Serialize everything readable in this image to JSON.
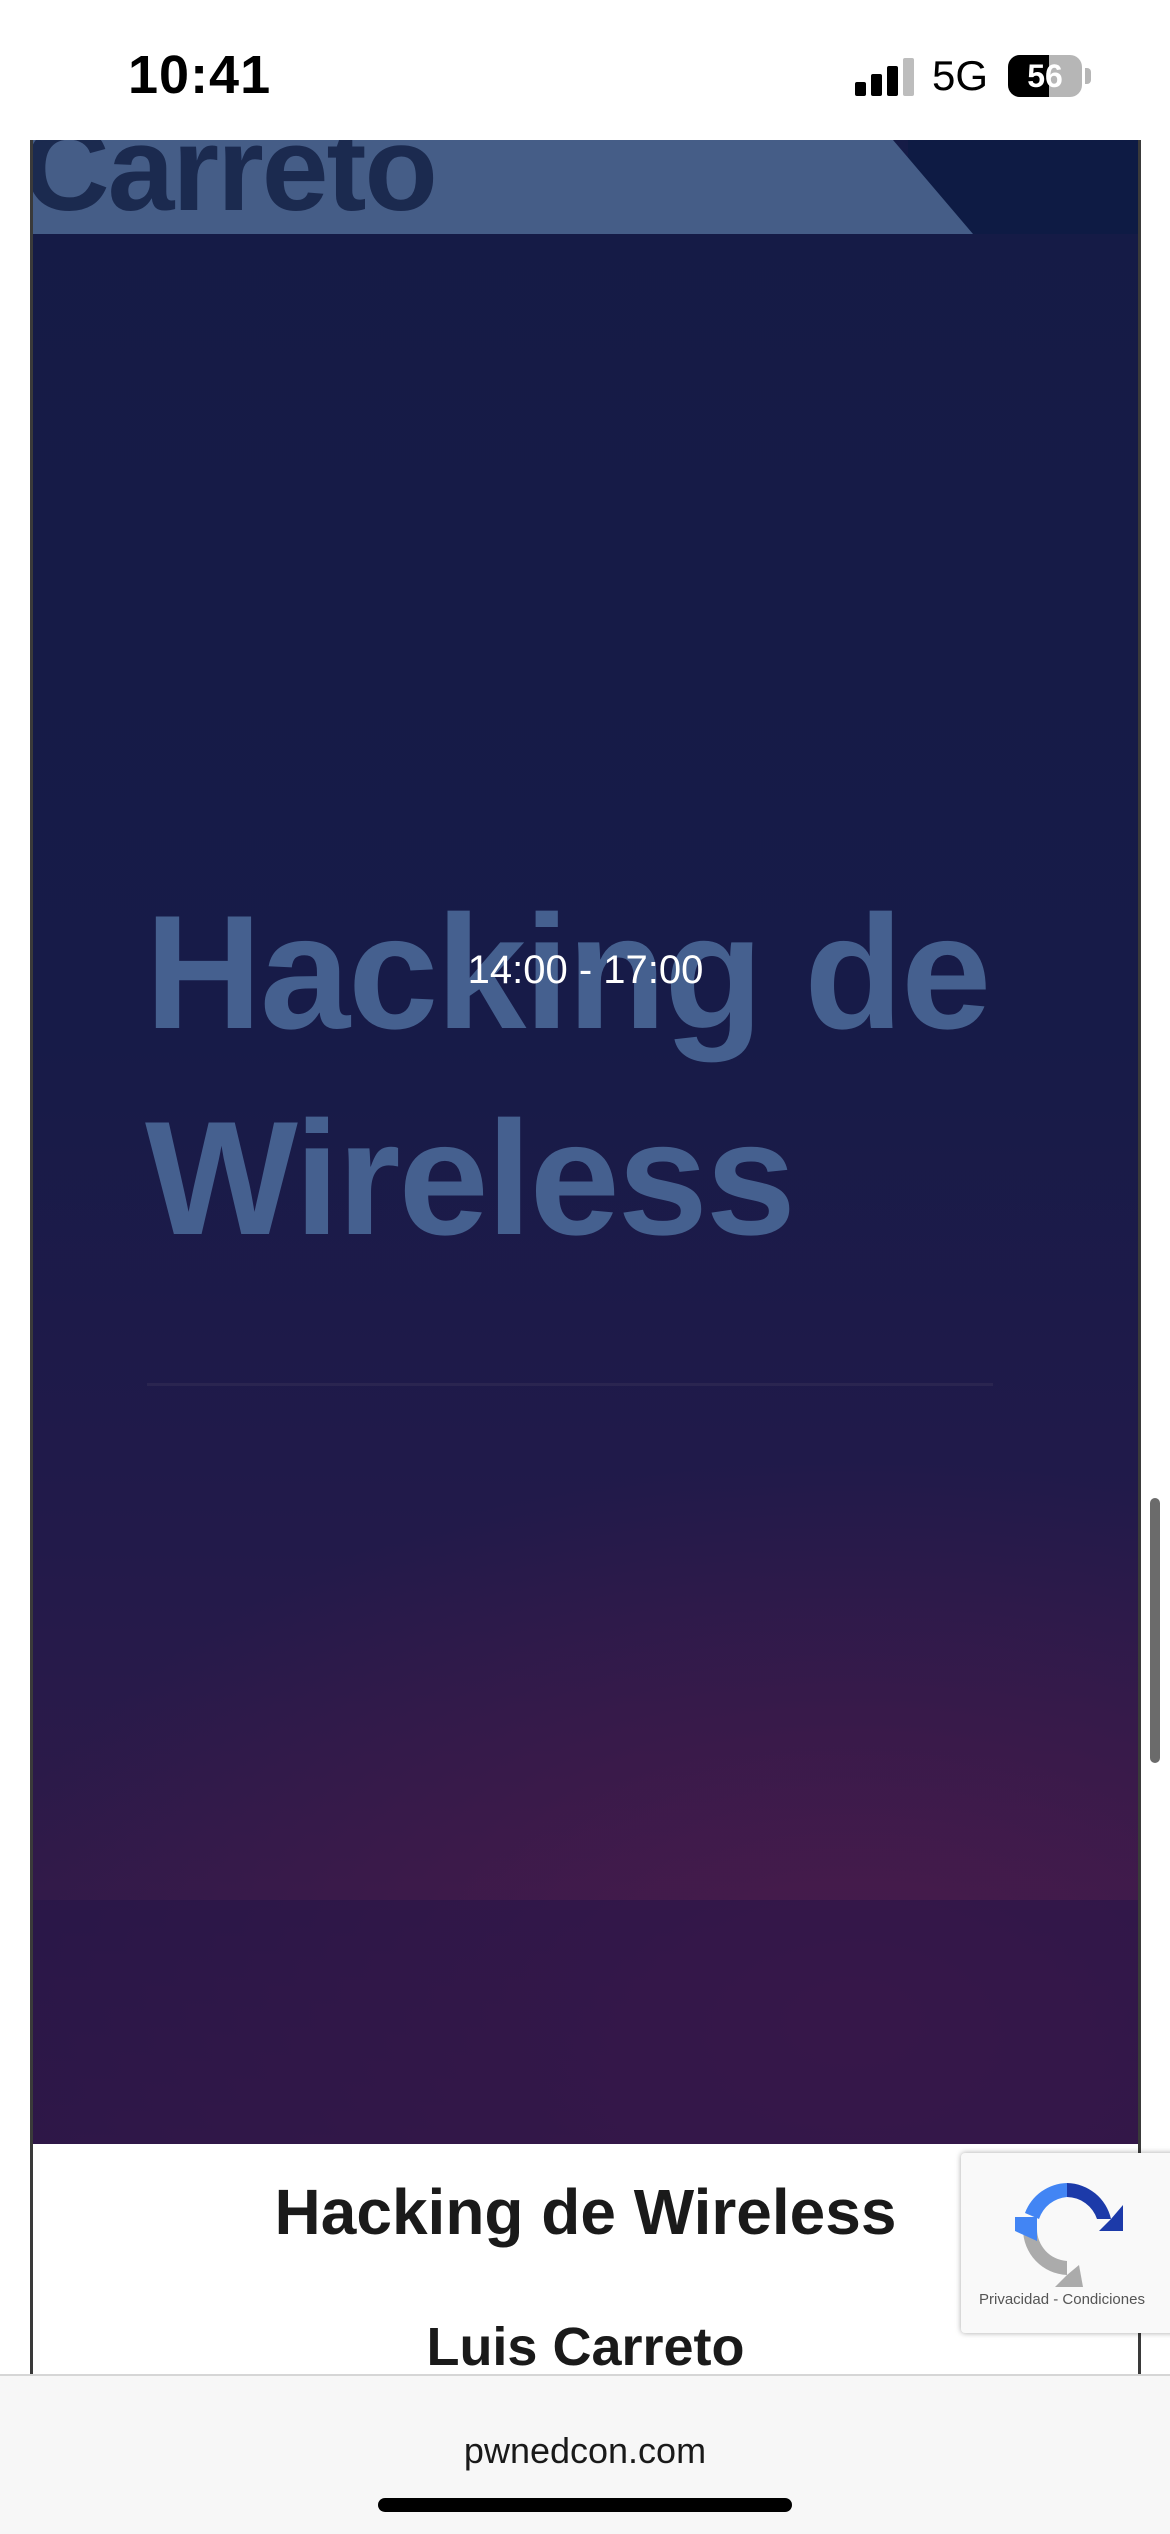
{
  "status_bar": {
    "time": "10:41",
    "network": "5G",
    "battery": "56"
  },
  "banner": {
    "speaker_partial": "Carreto",
    "title_line1": "Hacking de",
    "title_line2": "Wireless",
    "time_range": "14:00 - 17:00"
  },
  "card": {
    "title": "Hacking de Wireless",
    "speaker": "Luis Carreto"
  },
  "recaptcha": {
    "privacy": "Privacidad",
    "separator": "-",
    "terms": "Condiciones",
    "icon": "recaptcha-icon"
  },
  "browser": {
    "url": "pwnedcon.com"
  },
  "colors": {
    "banner_bg": "#171b48",
    "banner_text": "#45608f",
    "card_text": "#1a1a1a"
  }
}
